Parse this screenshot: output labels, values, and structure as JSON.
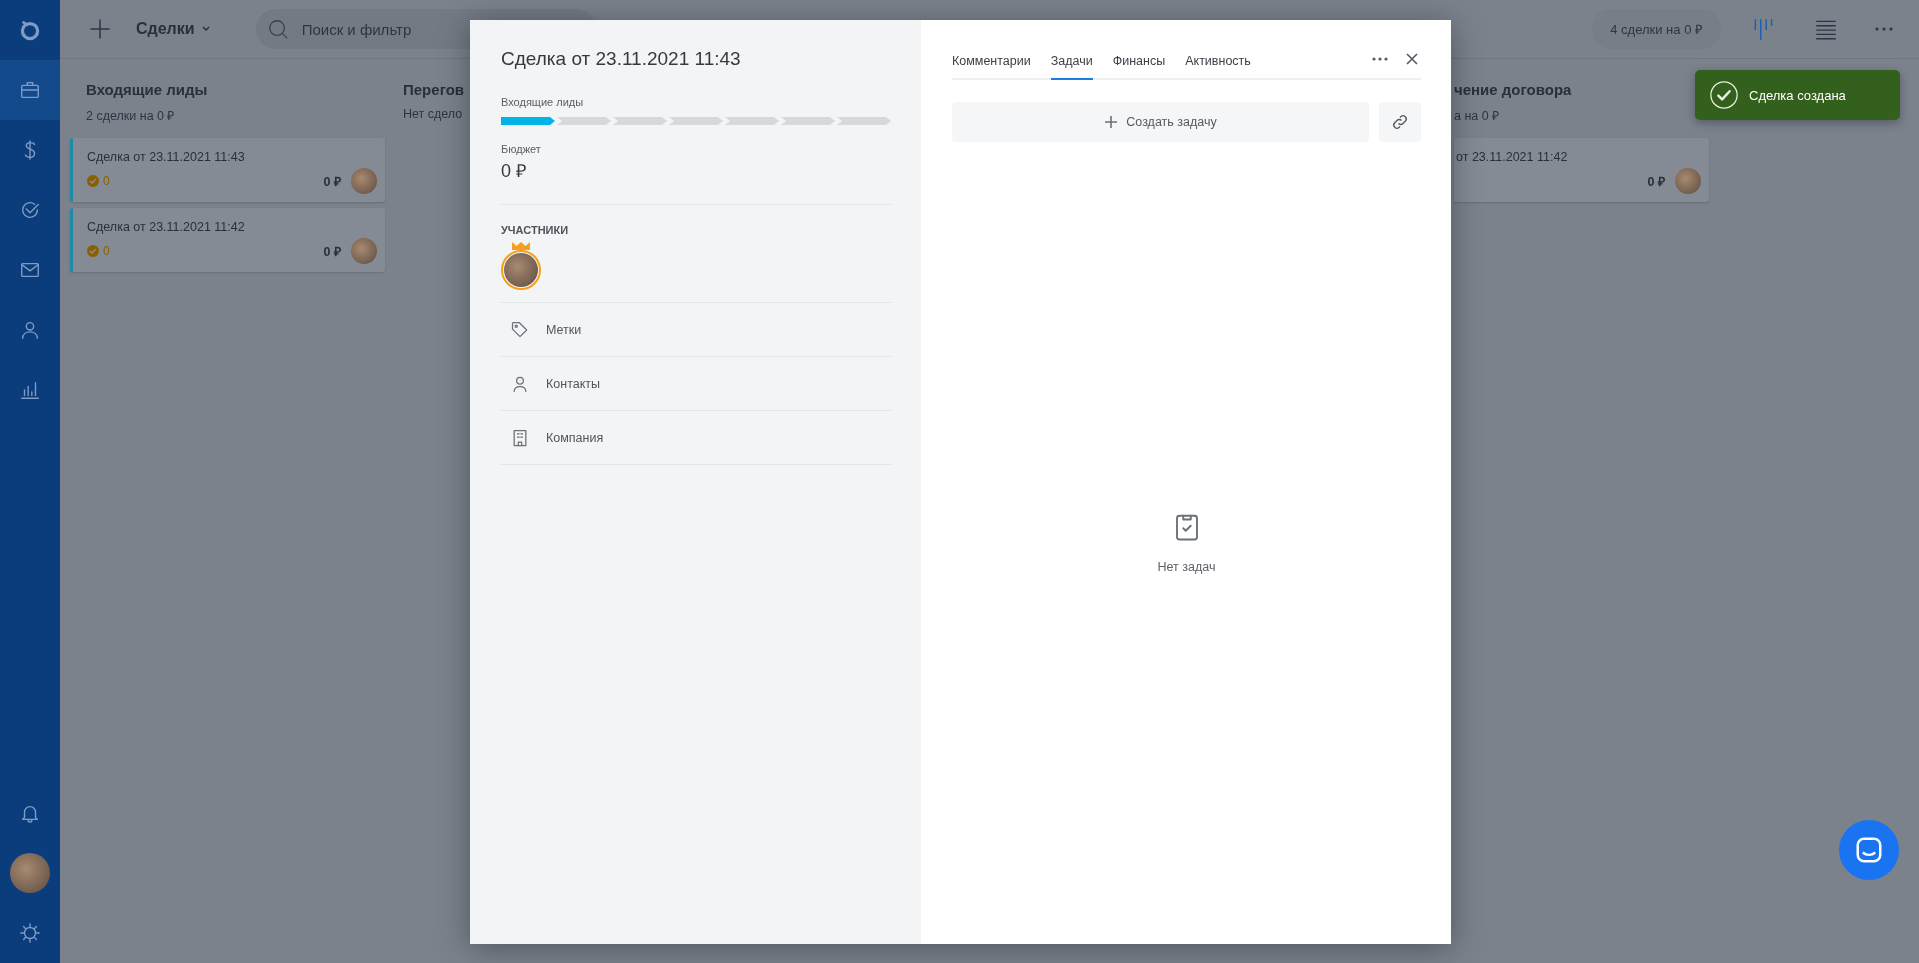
{
  "topbar": {
    "section": "Сделки",
    "search": {
      "placeholder": "Поиск и фильтр"
    },
    "summary": "4 сделки на 0 ₽",
    "view_modes": [
      {
        "kind": "kanban",
        "selected": true
      },
      {
        "kind": "list",
        "selected": false
      }
    ]
  },
  "board": {
    "columns": [
      {
        "title": "Входящие лиды",
        "subtitle": "2 сделки на 0 ₽",
        "cards": [
          {
            "title": "Сделка от 23.11.2021 11:43",
            "tasks": "0",
            "budget": "0 ₽"
          },
          {
            "title": "Сделка от 23.11.2021 11:42",
            "tasks": "0",
            "budget": "0 ₽"
          }
        ]
      },
      {
        "title": "Перегов",
        "subtitle": "Нет сдело"
      },
      {
        "title": "чение договора",
        "subtitle": "а на 0 ₽",
        "cards": [
          {
            "title": "от 23.11.2021 11:42",
            "budget": "0 ₽"
          }
        ]
      }
    ]
  },
  "deal": {
    "title": "Сделка от 23.11.2021 11:43",
    "stage": "Входящие лиды",
    "stages": [
      {
        "done": true
      },
      {
        "done": false
      },
      {
        "done": false
      },
      {
        "done": false
      },
      {
        "done": false
      },
      {
        "done": false
      },
      {
        "done": false
      }
    ],
    "budget_label": "Бюджет",
    "budget": "0 ₽",
    "participants_label": "УЧАСТНИКИ",
    "participants": [
      {
        "owner": true
      }
    ],
    "fields": [
      {
        "kind": "tag",
        "label": "Метки"
      },
      {
        "kind": "person",
        "label": "Контакты"
      },
      {
        "kind": "building",
        "label": "Компания"
      }
    ],
    "tabs": [
      {
        "label": "Комментарии",
        "selected": false
      },
      {
        "label": "Задачи",
        "selected": true
      },
      {
        "label": "Финансы",
        "selected": false
      },
      {
        "label": "Активность",
        "selected": false
      }
    ],
    "create_task": "Создать задачу",
    "empty_state": "Нет задач"
  },
  "toast": {
    "text": "Сделка создана"
  }
}
